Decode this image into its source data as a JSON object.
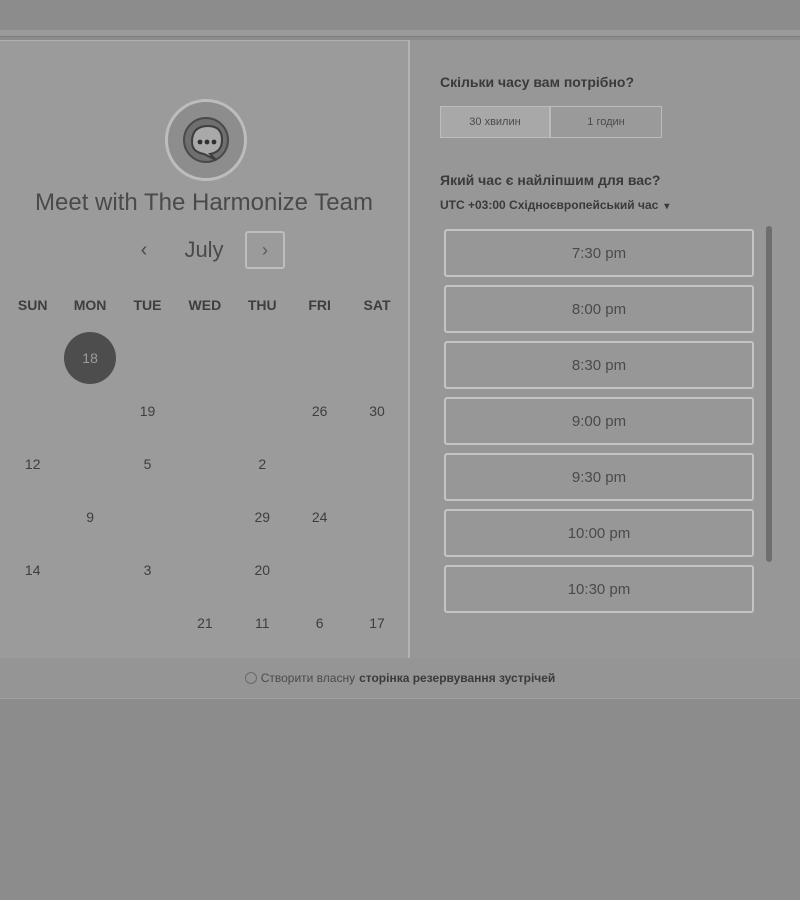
{
  "header": {
    "title": "Meet with The Harmonize Team",
    "month": "July",
    "prev_icon": "‹",
    "next_icon": "›"
  },
  "calendar": {
    "weekdays": [
      "SUN",
      "MON",
      "TUE",
      "WED",
      "THU",
      "FRI",
      "SAT"
    ],
    "selected_day": "18",
    "rows": [
      [
        "",
        "18",
        "",
        "",
        "",
        "",
        ""
      ],
      [
        "",
        "",
        "19",
        "",
        "",
        "26",
        "30"
      ],
      [
        "12",
        "",
        "5",
        "",
        "2",
        "",
        ""
      ],
      [
        "",
        "9",
        "",
        "",
        "29",
        "24",
        ""
      ],
      [
        "14",
        "",
        "3",
        "",
        "20",
        "",
        ""
      ],
      [
        "",
        "",
        "",
        "21",
        "11",
        "6",
        "17"
      ]
    ]
  },
  "duration": {
    "question": "Скільки часу вам потрібно?",
    "options": [
      "30 хвилин",
      "1 годин"
    ]
  },
  "time": {
    "question": "Який час є найліпшим для вас?",
    "timezone": "UTC +03:00 Східноєвропейський час",
    "caret": "▾",
    "slots": [
      "7:30 pm",
      "8:00 pm",
      "8:30 pm",
      "9:00 pm",
      "9:30 pm",
      "10:00 pm",
      "10:30 pm"
    ]
  },
  "footer": {
    "pre": "Створити власну",
    "link": "сторінка резервування зустрічей"
  },
  "colors": {
    "selected_day_bg": "#4d4d4d",
    "page_bg": "#8c8c8c"
  }
}
